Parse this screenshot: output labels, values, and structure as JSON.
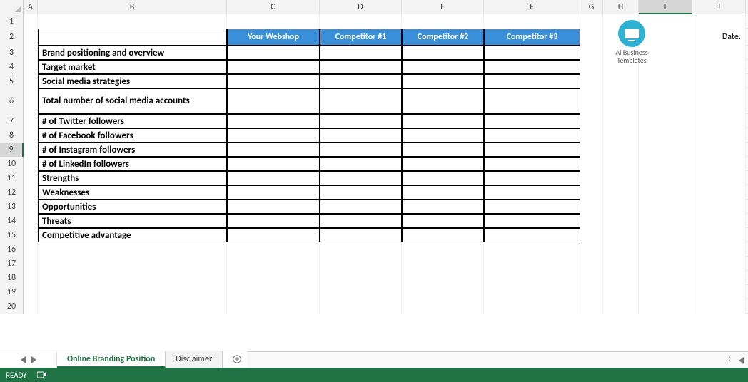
{
  "columns": [
    "A",
    "B",
    "C",
    "D",
    "E",
    "F",
    "G",
    "H",
    "I",
    "J"
  ],
  "rownums": [
    "1",
    "2",
    "3",
    "4",
    "5",
    "6",
    "7",
    "8",
    "9",
    "10",
    "11",
    "12",
    "13",
    "14",
    "15",
    "16",
    "17",
    "18",
    "19",
    "20"
  ],
  "selected_row": "9",
  "selected_col": "I",
  "header": {
    "c": "Your Webshop",
    "d": "Competitor #1",
    "e": "Competitor #2",
    "f": "Competitor #3"
  },
  "rows": [
    "Brand positioning and overview",
    "Target market",
    "Social media strategies",
    "Total number of social media accounts",
    "# of Twitter followers",
    "# of Facebook followers",
    "# of Instagram followers",
    "# of LinkedIn followers",
    "Strengths",
    "Weaknesses",
    "Opportunities",
    "Threats",
    "Competitive advantage"
  ],
  "date_label": "Date:",
  "logo": {
    "line1": "AllBusiness",
    "line2": "Templates"
  },
  "tabs": {
    "active": "Online Branding Position",
    "other": "Disclaimer"
  },
  "status": {
    "ready": "READY"
  },
  "chart_data": {
    "type": "table",
    "title": "",
    "columns": [
      "",
      "Your Webshop",
      "Competitor #1",
      "Competitor #2",
      "Competitor #3"
    ],
    "rows": [
      {
        "label": "Brand positioning and overview",
        "values": [
          "",
          "",
          "",
          ""
        ]
      },
      {
        "label": "Target market",
        "values": [
          "",
          "",
          "",
          ""
        ]
      },
      {
        "label": "Social media strategies",
        "values": [
          "",
          "",
          "",
          ""
        ]
      },
      {
        "label": "Total number of social media accounts",
        "values": [
          "",
          "",
          "",
          ""
        ]
      },
      {
        "label": "# of Twitter followers",
        "values": [
          "",
          "",
          "",
          ""
        ]
      },
      {
        "label": "# of Facebook followers",
        "values": [
          "",
          "",
          "",
          ""
        ]
      },
      {
        "label": "# of Instagram followers",
        "values": [
          "",
          "",
          "",
          ""
        ]
      },
      {
        "label": "# of LinkedIn followers",
        "values": [
          "",
          "",
          "",
          ""
        ]
      },
      {
        "label": "Strengths",
        "values": [
          "",
          "",
          "",
          ""
        ]
      },
      {
        "label": "Weaknesses",
        "values": [
          "",
          "",
          "",
          ""
        ]
      },
      {
        "label": "Opportunities",
        "values": [
          "",
          "",
          "",
          ""
        ]
      },
      {
        "label": "Threats",
        "values": [
          "",
          "",
          "",
          ""
        ]
      },
      {
        "label": "Competitive advantage",
        "values": [
          "",
          "",
          "",
          ""
        ]
      }
    ]
  }
}
